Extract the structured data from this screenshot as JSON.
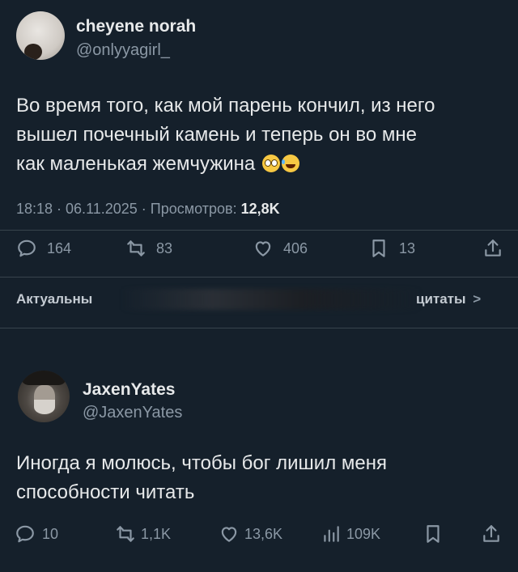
{
  "tweet1": {
    "name": "cheyene norah",
    "handle": "@onlyyagirl_",
    "text_line1": "Во время того, как мой парень кончил, из него",
    "text_line2": "вышел почечный камень и теперь он во мне",
    "text_line3": "как маленькая жемчужина",
    "time": "18:18 · 06.11.2025 · Просмотров:",
    "views": "12,8K",
    "replies": "164",
    "retweets": "83",
    "likes": "406",
    "bookmarks": "13",
    "relevant_label": "Актуальны",
    "quotes_label": "цитаты",
    "quotes_chevron": ">"
  },
  "tweet2": {
    "name": "JaxenYates",
    "handle": "@JaxenYates",
    "text_line1": "Иногда я молюсь, чтобы бог лишил меня",
    "text_line2": "способности читать",
    "replies": "10",
    "retweets": "1,1K",
    "likes": "13,6K",
    "views": "109K"
  },
  "colors": {
    "background": "#15202b",
    "text": "#e7e9ea",
    "secondary": "#8b98a5",
    "divider": "#38444d"
  },
  "icons": [
    "reply-icon",
    "retweet-icon",
    "like-icon",
    "bookmark-icon",
    "share-icon",
    "views-icon",
    "chevron-right-icon"
  ]
}
